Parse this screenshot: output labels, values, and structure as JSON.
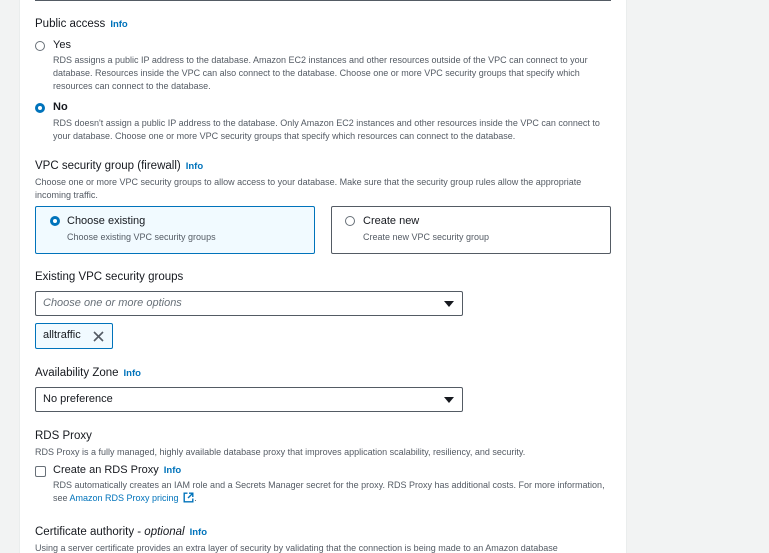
{
  "public_access": {
    "title": "Public access",
    "info": "Info",
    "options": [
      {
        "label": "Yes",
        "checked": false,
        "description": "RDS assigns a public IP address to the database. Amazon EC2 instances and other resources outside of the VPC can connect to your database. Resources inside the VPC can also connect to the database. Choose one or more VPC security groups that specify which resources can connect to the database."
      },
      {
        "label": "No",
        "checked": true,
        "description": "RDS doesn't assign a public IP address to the database. Only Amazon EC2 instances and other resources inside the VPC can connect to your database. Choose one or more VPC security groups that specify which resources can connect to the database."
      }
    ]
  },
  "vpc_security_group": {
    "title": "VPC security group (firewall)",
    "info": "Info",
    "description": "Choose one or more VPC security groups to allow access to your database. Make sure that the security group rules allow the appropriate incoming traffic.",
    "choose_existing": {
      "label": "Choose existing",
      "description": "Choose existing VPC security groups",
      "checked": true
    },
    "create_new": {
      "label": "Create new",
      "description": "Create new VPC security group",
      "checked": false
    }
  },
  "existing_groups": {
    "title": "Existing VPC security groups",
    "placeholder": "Choose one or more options",
    "tokens": [
      "alltraffic"
    ]
  },
  "availability_zone": {
    "title": "Availability Zone",
    "info": "Info",
    "value": "No preference"
  },
  "rds_proxy": {
    "title": "RDS Proxy",
    "description": "RDS Proxy is a fully managed, highly available database proxy that improves application scalability, resiliency, and security.",
    "checkbox_label": "Create an RDS Proxy",
    "info": "Info",
    "checked": false,
    "detail_prefix": "RDS automatically creates an IAM role and a Secrets Manager secret for the proxy. RDS Proxy has additional costs. For more information, see ",
    "link_text": "Amazon RDS Proxy pricing",
    "detail_suffix": "."
  },
  "certificate_authority": {
    "title_main": "Certificate authority - ",
    "title_optional": "optional",
    "info": "Info",
    "description": "Using a server certificate provides an extra layer of security by validating that the connection is being made to an Amazon database"
  },
  "colors": {
    "accent": "#0073bb",
    "text": "#16191f",
    "muted": "#545b64",
    "selected_bg": "#f1faff"
  }
}
